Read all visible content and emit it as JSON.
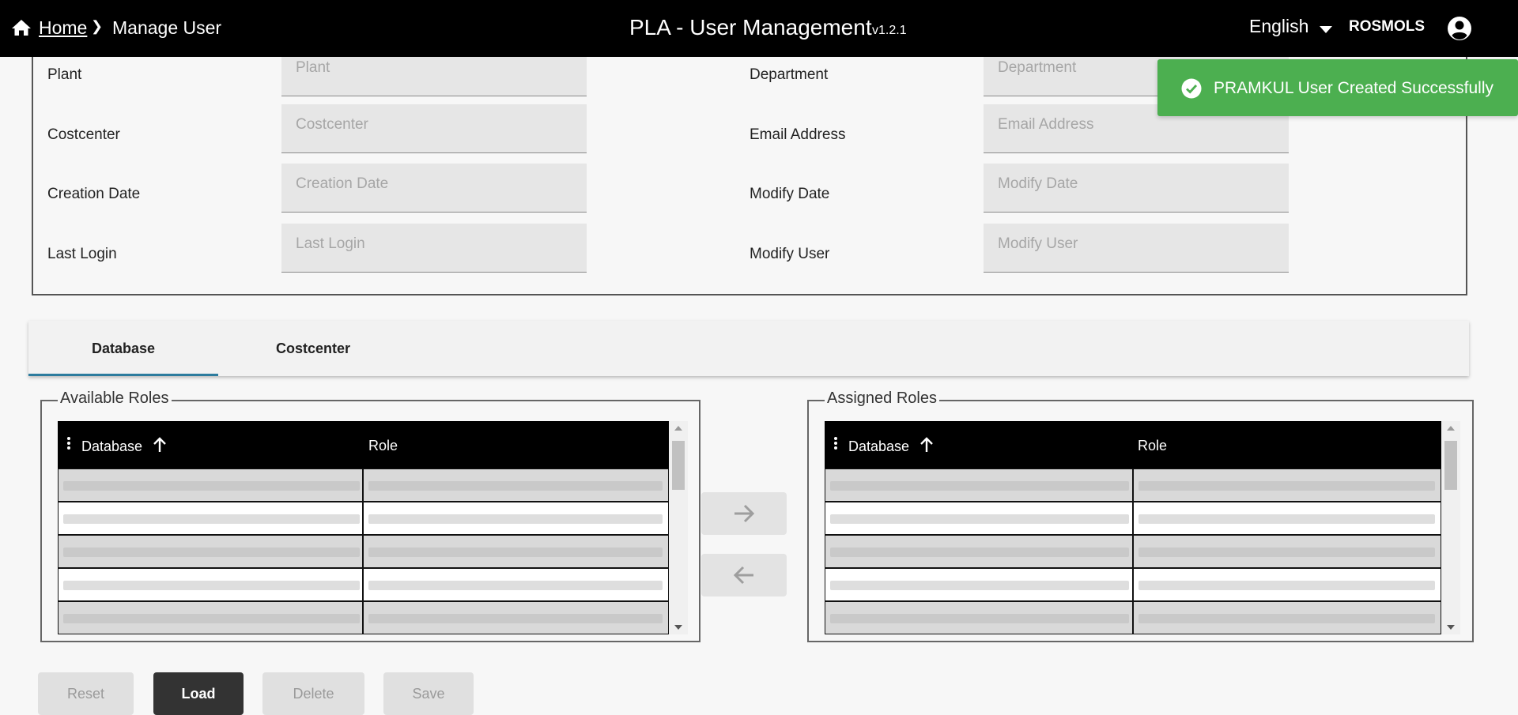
{
  "header": {
    "breadcrumb_home": "Home",
    "breadcrumb_separator": "❯",
    "breadcrumb_current": "Manage User",
    "title": "PLA - User Management",
    "version": "v1.2.1",
    "language": "English",
    "username": "ROSMOLS"
  },
  "details": {
    "left_fields": [
      {
        "label": "Plant",
        "placeholder": "Plant",
        "value": ""
      },
      {
        "label": "Costcenter",
        "placeholder": "Costcenter",
        "value": ""
      },
      {
        "label": "Creation Date",
        "placeholder": "Creation Date",
        "value": ""
      },
      {
        "label": "Last Login",
        "placeholder": "Last Login",
        "value": ""
      }
    ],
    "right_fields": [
      {
        "label": "Department",
        "placeholder": "Department",
        "value": ""
      },
      {
        "label": "Email Address",
        "placeholder": "Email Address",
        "value": ""
      },
      {
        "label": "Modify Date",
        "placeholder": "Modify Date",
        "value": ""
      },
      {
        "label": "Modify User",
        "placeholder": "Modify User",
        "value": ""
      }
    ]
  },
  "tabs": [
    {
      "label": "Database",
      "active": true
    },
    {
      "label": "Costcenter",
      "active": false
    }
  ],
  "available_roles": {
    "legend": "Available Roles",
    "columns": [
      "Database",
      "Role"
    ],
    "sort": "ascending",
    "row_count_visible": 5
  },
  "assigned_roles": {
    "legend": "Assigned Roles",
    "columns": [
      "Database",
      "Role"
    ],
    "sort": "ascending",
    "row_count_visible": 5
  },
  "transfer": {
    "add_icon": "arrow-right-icon",
    "remove_icon": "arrow-left-icon"
  },
  "actions": {
    "reset": "Reset",
    "load": "Load",
    "delete": "Delete",
    "save": "Save"
  },
  "toast": {
    "message": "PRAMKUL User Created Successfully",
    "color": "#4caf50"
  },
  "colors": {
    "header_bg": "#000000",
    "tab_active_underline": "#2d7c9e",
    "primary_button": "#333333"
  }
}
